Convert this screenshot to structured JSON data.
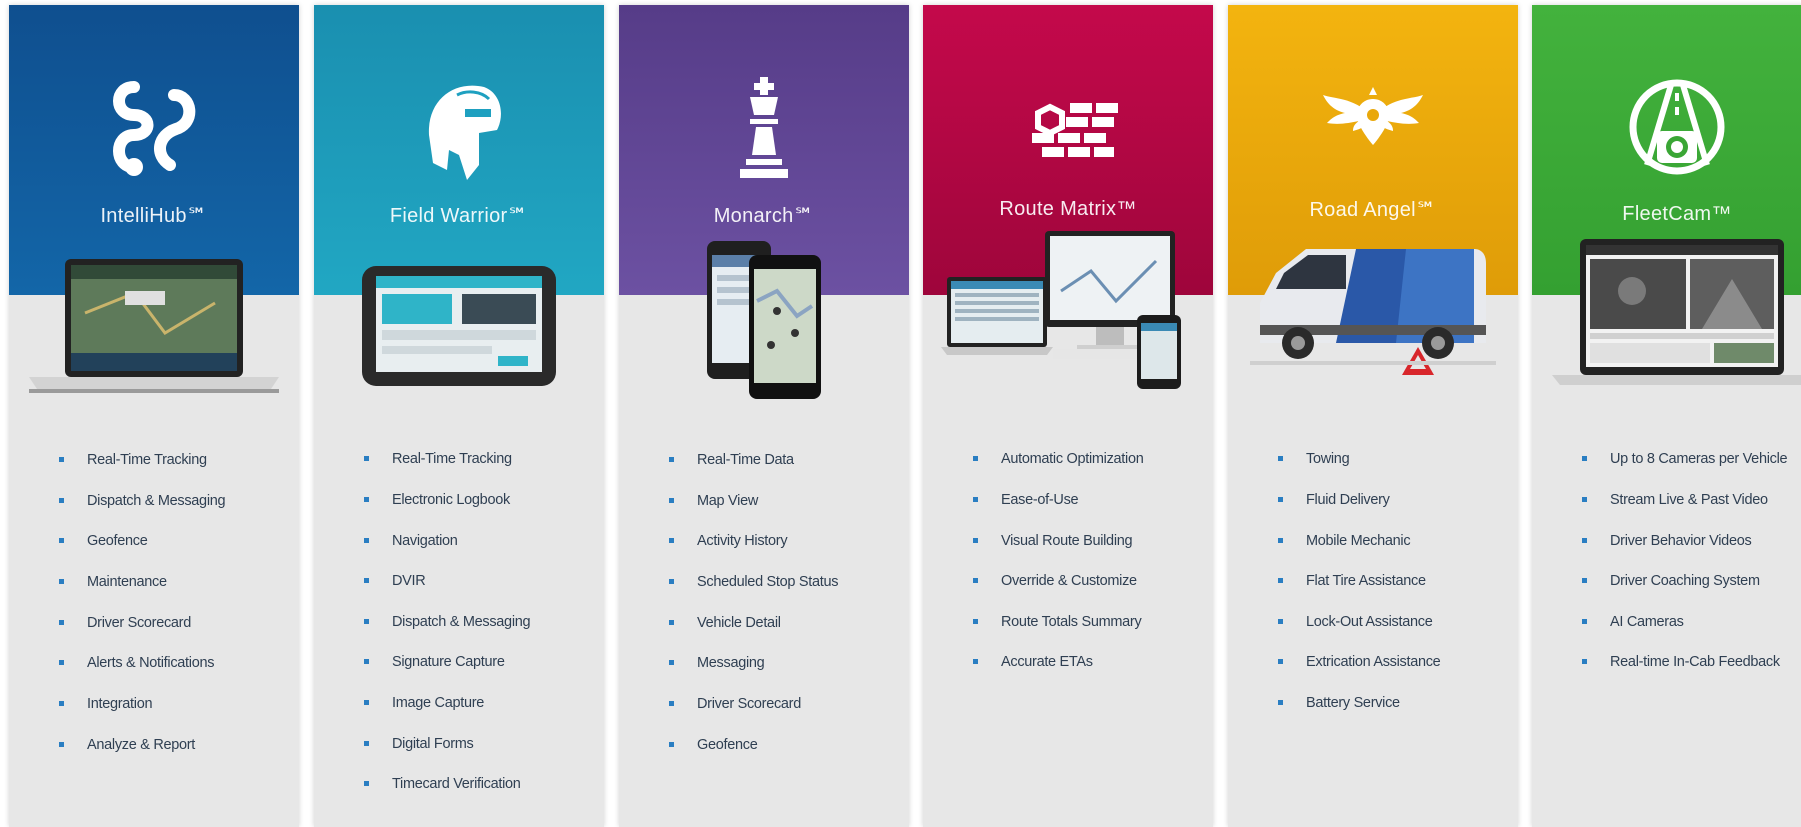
{
  "products": [
    {
      "id": "intellihub",
      "name": "IntelliHub℠",
      "logo_icon": "intellihub-logo-icon",
      "device_icon": "laptop-icon",
      "header_color_top": "#0f4f8f",
      "header_color_bottom": "#136aab",
      "features": [
        "Real-Time Tracking",
        "Dispatch & Messaging",
        "Geofence",
        "Maintenance",
        "Driver Scorecard",
        "Alerts & Notifications",
        "Integration",
        "Analyze & Report"
      ]
    },
    {
      "id": "field-warrior",
      "name": "Field Warrior℠",
      "logo_icon": "spartan-helmet-icon",
      "device_icon": "tablet-icon",
      "header_color_top": "#1b8fb0",
      "header_color_bottom": "#1ea6c2",
      "features": [
        "Real-Time Tracking",
        "Electronic Logbook",
        "Navigation",
        "DVIR",
        "Dispatch & Messaging",
        "Signature Capture",
        "Image Capture",
        "Digital Forms",
        "Timecard Verification"
      ]
    },
    {
      "id": "monarch",
      "name": "Monarch℠",
      "logo_icon": "chess-king-icon",
      "device_icon": "smartphones-icon",
      "header_color_top": "#5a3f8c",
      "header_color_bottom": "#6f52a3",
      "features": [
        "Real-Time Data",
        "Map View",
        "Activity History",
        "Scheduled Stop Status",
        "Vehicle Detail",
        "Messaging",
        "Driver Scorecard",
        "Geofence"
      ]
    },
    {
      "id": "route-matrix",
      "name": "Route Matrix™",
      "logo_icon": "route-matrix-logo-icon",
      "device_icon": "multi-device-icon",
      "header_color_top": "#c2094a",
      "header_color_bottom": "#a2063c",
      "features": [
        "Automatic Optimization",
        "Ease-of-Use",
        "Visual Route Building",
        "Override & Customize",
        "Route Totals Summary",
        "Accurate ETAs"
      ]
    },
    {
      "id": "road-angel",
      "name": "Road Angel℠",
      "logo_icon": "winged-pin-icon",
      "device_icon": "van-icon",
      "header_color_top": "#f2b10c",
      "header_color_bottom": "#e09e08",
      "features": [
        "Towing",
        "Fluid Delivery",
        "Mobile Mechanic",
        "Flat Tire Assistance",
        "Lock-Out Assistance",
        "Extrication Assistance",
        "Battery Service"
      ]
    },
    {
      "id": "fleetcam",
      "name": "FleetCam™",
      "logo_icon": "road-camera-icon",
      "device_icon": "laptop-icon",
      "header_color_top": "#3fae3a",
      "header_color_bottom": "#36a032",
      "features": [
        "Up to 8 Cameras per Vehicle",
        "Stream Live & Past Video",
        "Driver Behavior Videos",
        "Driver Coaching System",
        "AI Cameras",
        "Real-time In-Cab Feedback"
      ]
    }
  ],
  "colors": {
    "card_body": "#e7e7e7",
    "bullet": "#2a7ec2",
    "feature_text": "#2f3f52"
  }
}
